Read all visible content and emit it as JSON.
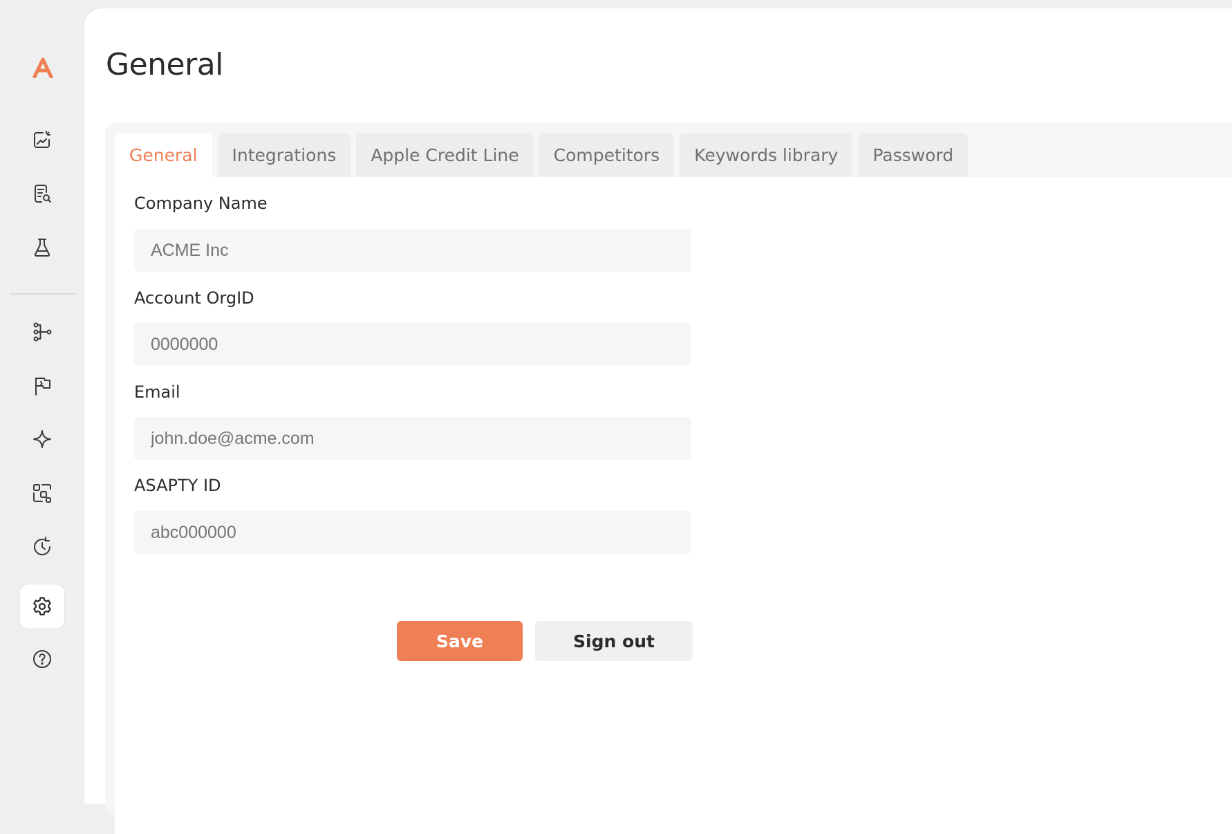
{
  "app": {
    "accent_color": "#ef8055"
  },
  "sidebar": {
    "logo_letter": "A",
    "items": [
      {
        "name": "dashboard",
        "icon": "chart-edit-icon",
        "active": false
      },
      {
        "name": "reports",
        "icon": "document-search-icon",
        "active": false
      },
      {
        "name": "experiments",
        "icon": "flask-icon",
        "active": false
      },
      {
        "name": "automation",
        "icon": "workflow-icon",
        "active": false
      },
      {
        "name": "campaigns",
        "icon": "flag-icon",
        "active": false
      },
      {
        "name": "ai",
        "icon": "sparkle-icon",
        "active": false
      },
      {
        "name": "integrations",
        "icon": "blocks-icon",
        "active": false
      },
      {
        "name": "history",
        "icon": "clock-history-icon",
        "active": false
      },
      {
        "name": "settings",
        "icon": "gear-icon",
        "active": true
      },
      {
        "name": "help",
        "icon": "help-circle-icon",
        "active": false
      }
    ]
  },
  "page": {
    "title": "General"
  },
  "tabs": [
    {
      "label": "General",
      "active": true
    },
    {
      "label": "Integrations",
      "active": false
    },
    {
      "label": "Apple Credit Line",
      "active": false
    },
    {
      "label": "Competitors",
      "active": false
    },
    {
      "label": "Keywords library",
      "active": false
    },
    {
      "label": "Password",
      "active": false
    }
  ],
  "form": {
    "company_name": {
      "label": "Company Name",
      "placeholder": "ACME Inc"
    },
    "org_id": {
      "label": "Account OrgID",
      "placeholder": "0000000"
    },
    "email": {
      "label": "Email",
      "placeholder": "john.doe@acme.com"
    },
    "asapty_id": {
      "label": "ASAPTY ID",
      "placeholder": "abc000000"
    }
  },
  "buttons": {
    "save": "Save",
    "sign_out": "Sign out"
  }
}
